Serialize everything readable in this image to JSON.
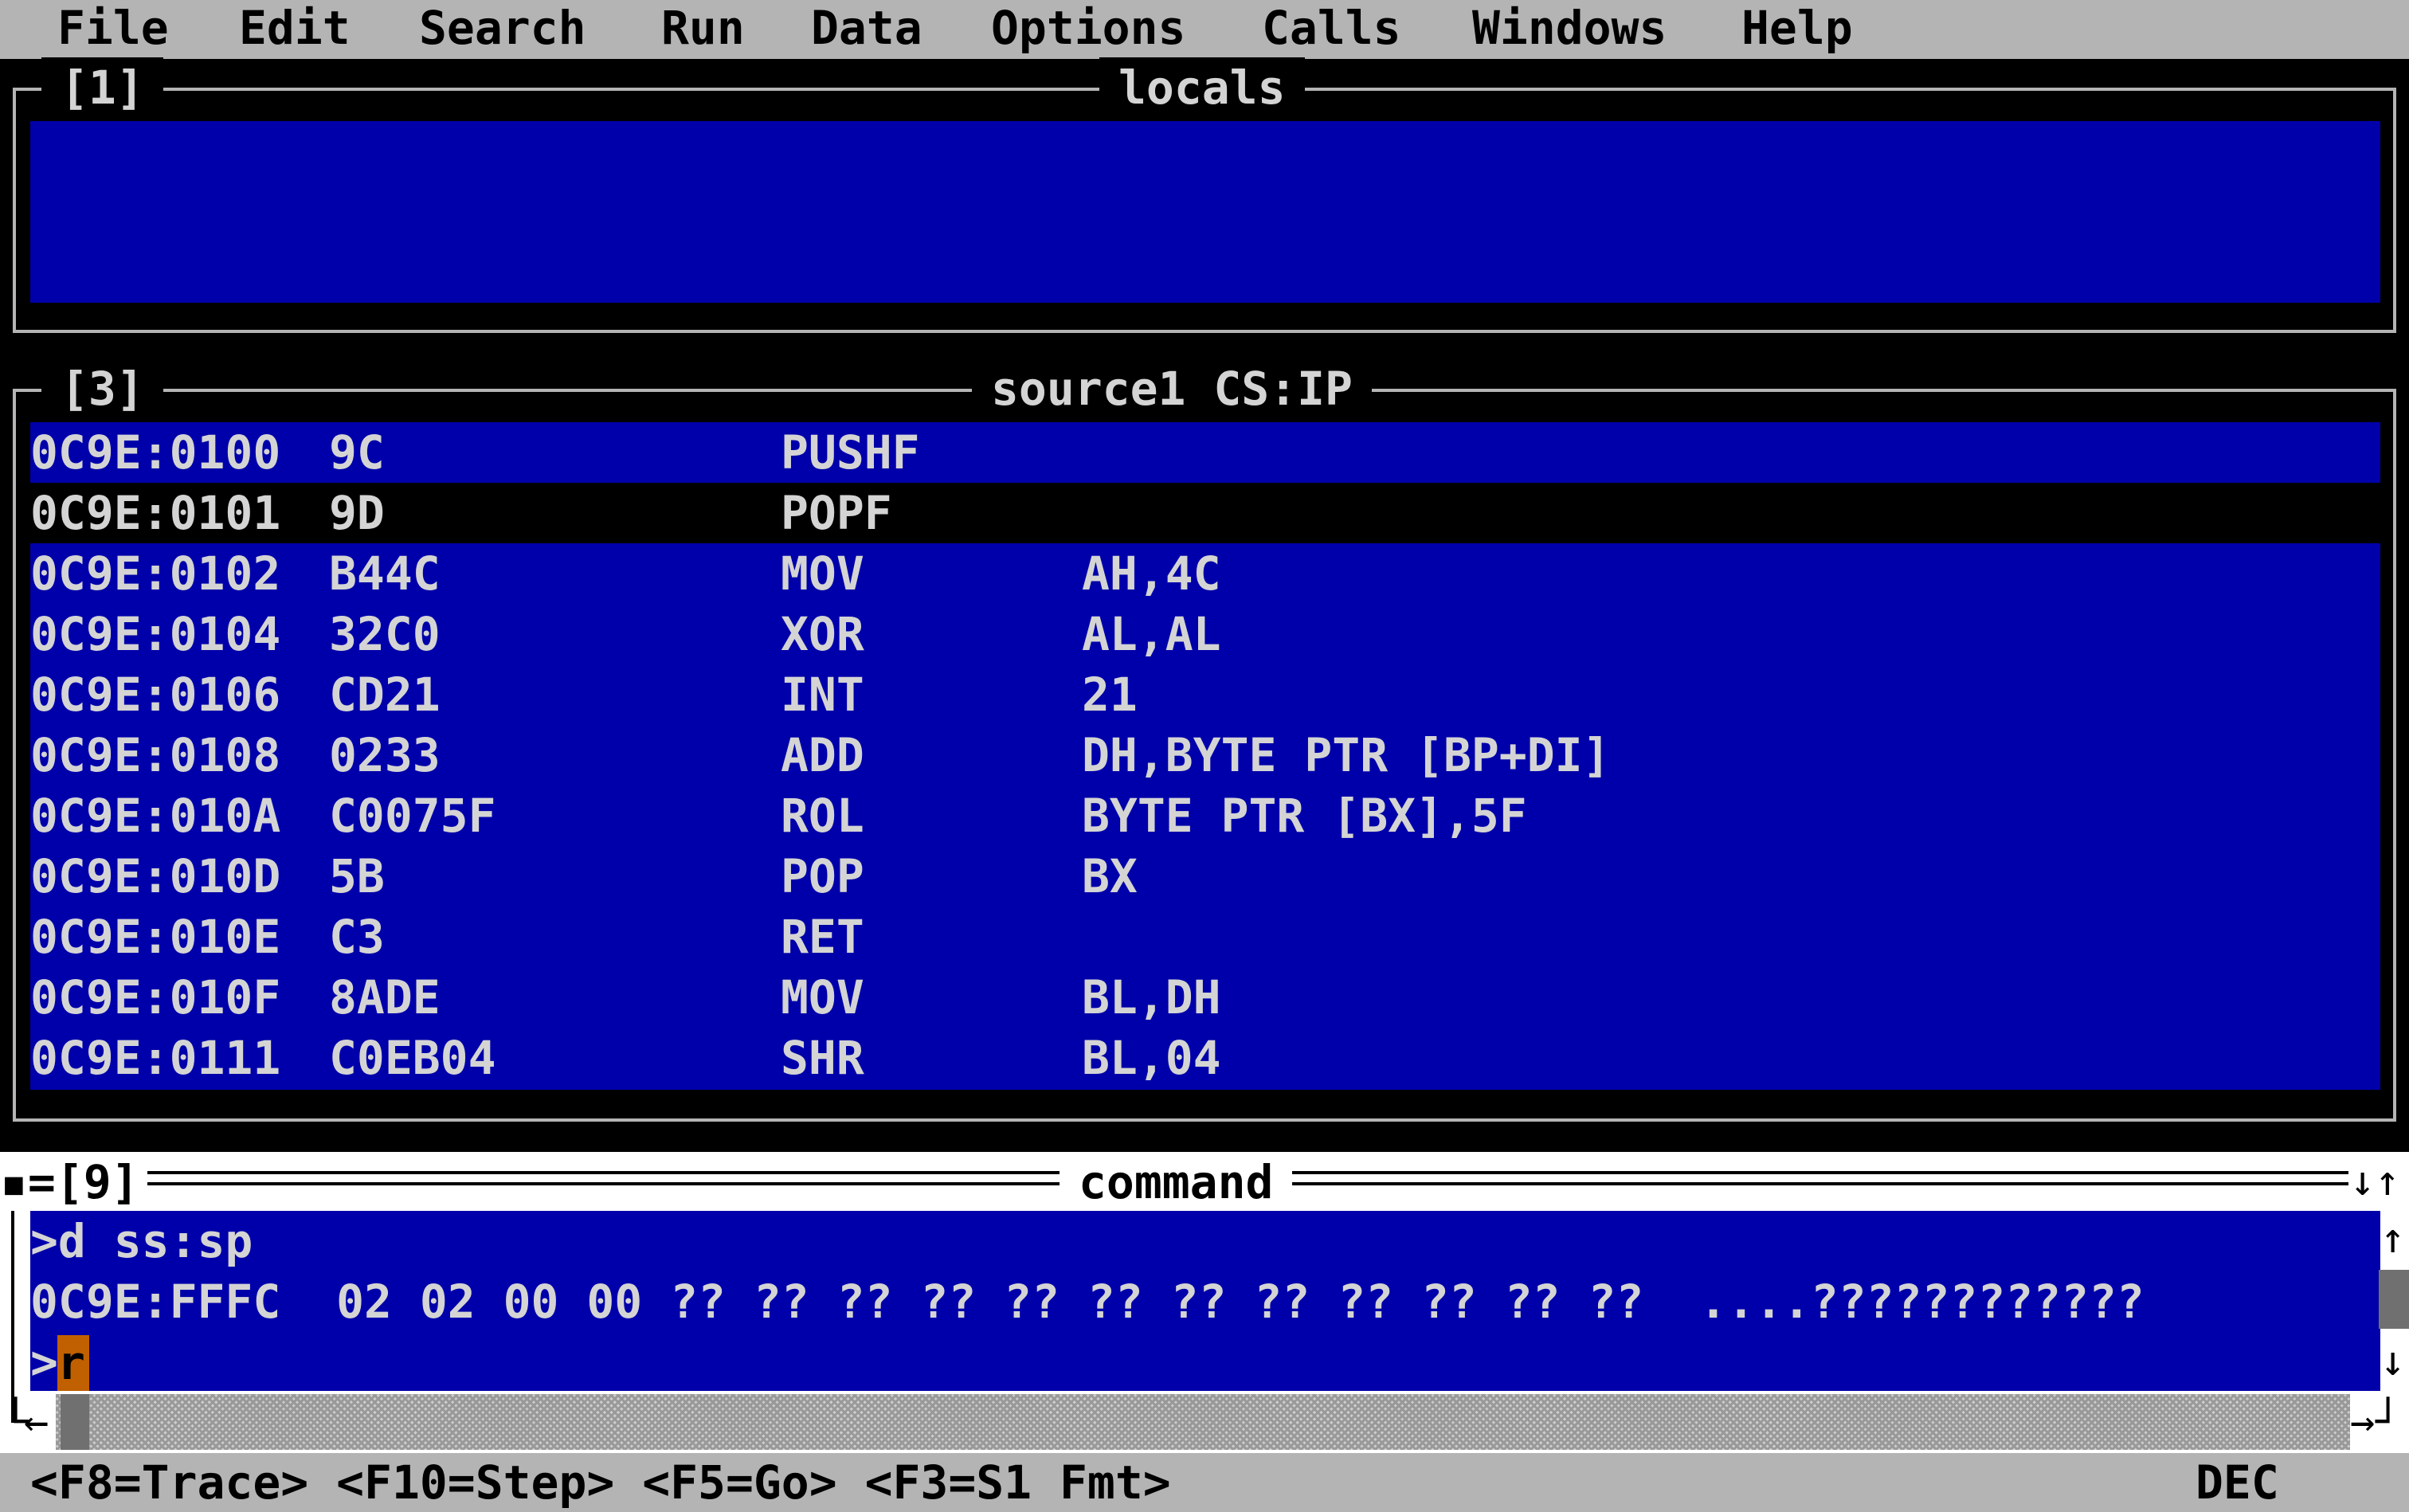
{
  "menu": [
    "File",
    "Edit",
    "Search",
    "Run",
    "Data",
    "Options",
    "Calls",
    "Windows",
    "Help"
  ],
  "locals_window": {
    "number": "[1]",
    "title": "locals"
  },
  "source_window": {
    "number": "[3]",
    "title": "source1 CS:IP",
    "rows": [
      {
        "addr": "0C9E:0100",
        "bytes": "9C",
        "mnem": "PUSHF",
        "oper": ""
      },
      {
        "addr": "0C9E:0101",
        "bytes": "9D",
        "mnem": "POPF",
        "oper": ""
      },
      {
        "addr": "0C9E:0102",
        "bytes": "B44C",
        "mnem": "MOV",
        "oper": "AH,4C"
      },
      {
        "addr": "0C9E:0104",
        "bytes": "32C0",
        "mnem": "XOR",
        "oper": "AL,AL"
      },
      {
        "addr": "0C9E:0106",
        "bytes": "CD21",
        "mnem": "INT",
        "oper": "21"
      },
      {
        "addr": "0C9E:0108",
        "bytes": "0233",
        "mnem": "ADD",
        "oper": "DH,BYTE PTR [BP+DI]"
      },
      {
        "addr": "0C9E:010A",
        "bytes": "C0075F",
        "mnem": "ROL",
        "oper": "BYTE PTR [BX],5F"
      },
      {
        "addr": "0C9E:010D",
        "bytes": "5B",
        "mnem": "POP",
        "oper": "BX"
      },
      {
        "addr": "0C9E:010E",
        "bytes": "C3",
        "mnem": "RET",
        "oper": ""
      },
      {
        "addr": "0C9E:010F",
        "bytes": "8ADE",
        "mnem": "MOV",
        "oper": "BL,DH"
      },
      {
        "addr": "0C9E:0111",
        "bytes": "C0EB04",
        "mnem": "SHR",
        "oper": "BL,04"
      }
    ]
  },
  "command_window": {
    "label": "▪=[9]",
    "title": "command",
    "lines": [
      ">d ss:sp",
      "0C9E:FFFC  02 02 00 00 ?? ?? ?? ?? ?? ?? ?? ?? ?? ?? ?? ??  ....????????????",
      ">"
    ],
    "input_value": "r"
  },
  "status": {
    "keys": "<F8=Trace> <F10=Step> <F5=Go> <F3=S1 Fmt>",
    "mode": "DEC"
  },
  "icons": {
    "maximize": "↓↑",
    "scroll_up": "↑",
    "scroll_down": "↓",
    "scroll_left": "←",
    "scroll_right": "→",
    "corner_left": "└",
    "resize": "┘"
  }
}
